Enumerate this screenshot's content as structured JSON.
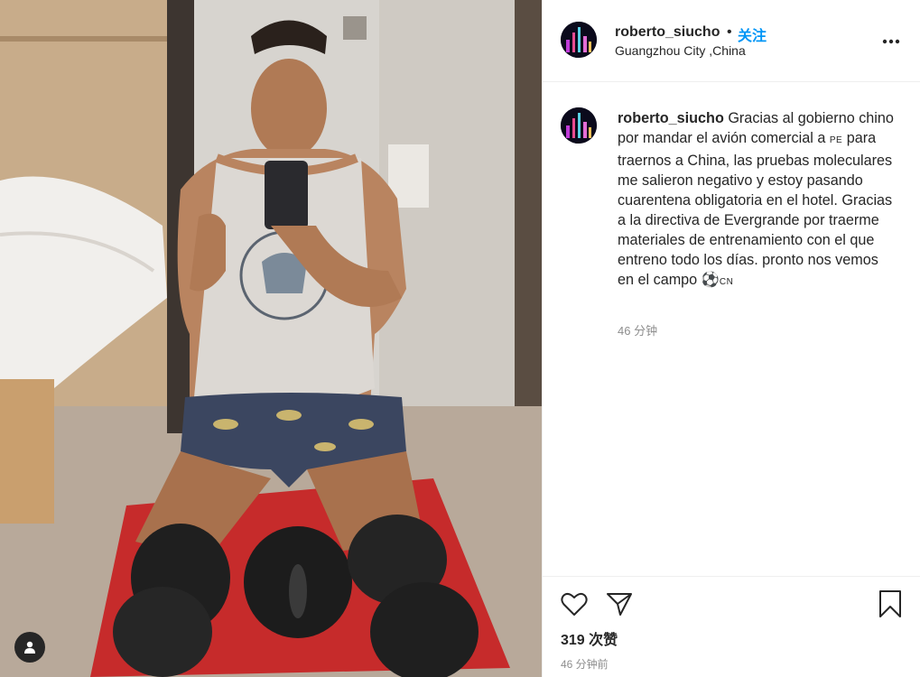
{
  "post": {
    "username": "roberto_siucho",
    "separator": "•",
    "follow_label": "关注",
    "location": "Guangzhou City ,China",
    "more_label": "•••",
    "caption_text": "Gracias al gobierno chino por mandar el avión comercial a",
    "caption_flag_pe": "PE",
    "caption_text_2": "para traernos a China, las pruebas moleculares me salieron negativo y estoy pasando cuarentena obligatoria en el hotel. Gracias a la directiva de Evergrande por traerme materiales de entrenamiento con el que entreno todo los días. pronto nos vemos en el campo",
    "caption_ball": "⚽",
    "caption_flag_cn": "CN",
    "caption_time": "46 分钟",
    "likes": "319 次赞",
    "post_time": "46 分钟前"
  },
  "icons": {
    "like": "heart-icon",
    "share": "paper-plane-icon",
    "save": "bookmark-icon",
    "more": "more-dots-icon",
    "user_tag": "user-silhouette-icon"
  },
  "colors": {
    "follow_blue": "#0095f6",
    "text_primary": "#262626",
    "text_secondary": "#8e8e8e",
    "divider": "#efefef"
  }
}
